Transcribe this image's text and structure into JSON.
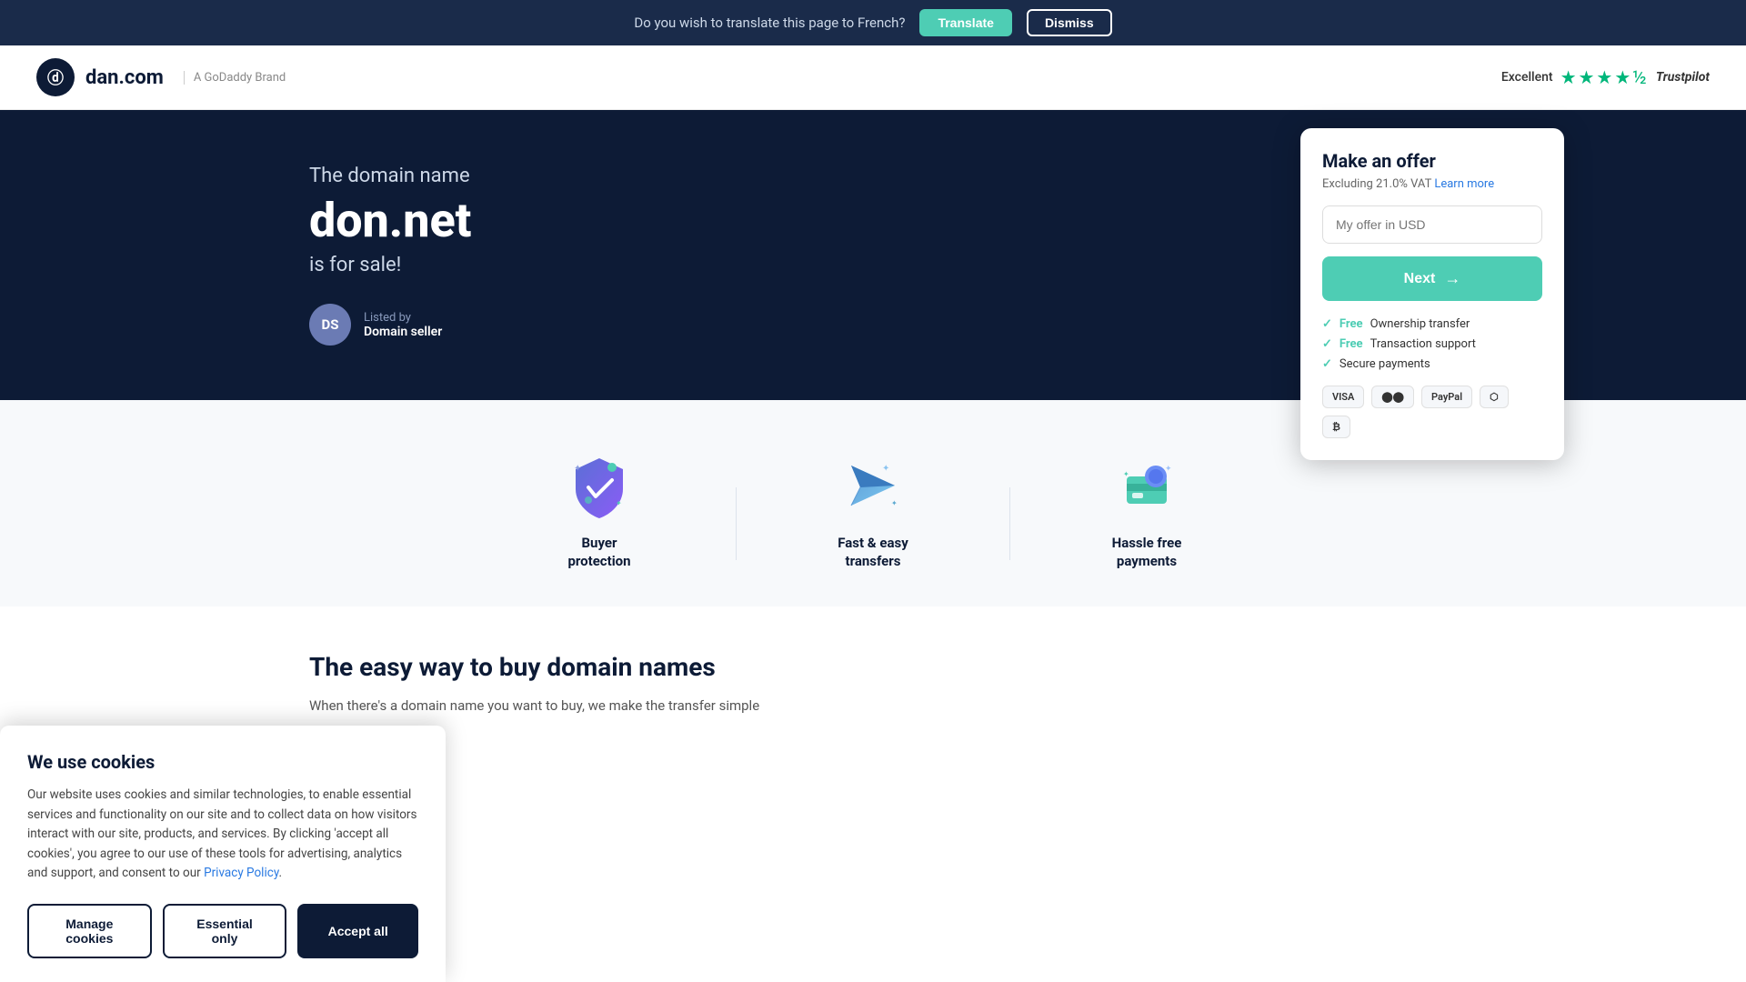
{
  "translateBar": {
    "message": "Do you wish to translate this page to French?",
    "translateLabel": "Translate",
    "dismissLabel": "Dismiss"
  },
  "header": {
    "logoText": "dan.com",
    "logoInitials": "ⓓ",
    "godaddyBrand": "A GoDaddy Brand",
    "trustpilot": {
      "rating": "Excellent",
      "stars": "★★★★",
      "halfStar": "★",
      "brand": "Trustpilot"
    }
  },
  "hero": {
    "subtitle": "The domain name",
    "domain": "don.net",
    "forsale": "is for sale!",
    "sellerInitials": "DS",
    "listedBy": "Listed by",
    "sellerName": "Domain seller"
  },
  "offerCard": {
    "title": "Make an offer",
    "vatText": "Excluding 21.0% VAT",
    "learnMore": "Learn more",
    "inputPlaceholder": "My offer in USD",
    "nextLabel": "Next",
    "perks": [
      {
        "label": "Ownership transfer",
        "free": true
      },
      {
        "label": "Transaction support",
        "free": true
      },
      {
        "label": "Secure payments",
        "free": false
      }
    ],
    "paymentMethods": [
      "VISA",
      "MC",
      "PayPal",
      "Amex",
      "BTC"
    ]
  },
  "features": [
    {
      "icon": "shield",
      "label": "Buyer\nprotection"
    },
    {
      "icon": "plane",
      "label": "Fast & easy\ntransfers"
    },
    {
      "icon": "payment",
      "label": "Hassle free\npayments"
    }
  ],
  "whySection": {
    "title": "The easy way to buy domain names",
    "text": "When there's a domain name you want to buy, we make the transfer simple"
  },
  "cookieBanner": {
    "title": "We use cookies",
    "text": "Our website uses cookies and similar technologies, to enable essential services and functionality on our site and to collect data on how visitors interact with our site, products, and services. By clicking 'accept all cookies', you agree to our use of these tools for advertising, analytics and support, and consent to our",
    "privacyPolicy": "Privacy Policy",
    "period": ".",
    "manageLabel": "Manage cookies",
    "essentialLabel": "Essential only",
    "acceptLabel": "Accept all"
  }
}
